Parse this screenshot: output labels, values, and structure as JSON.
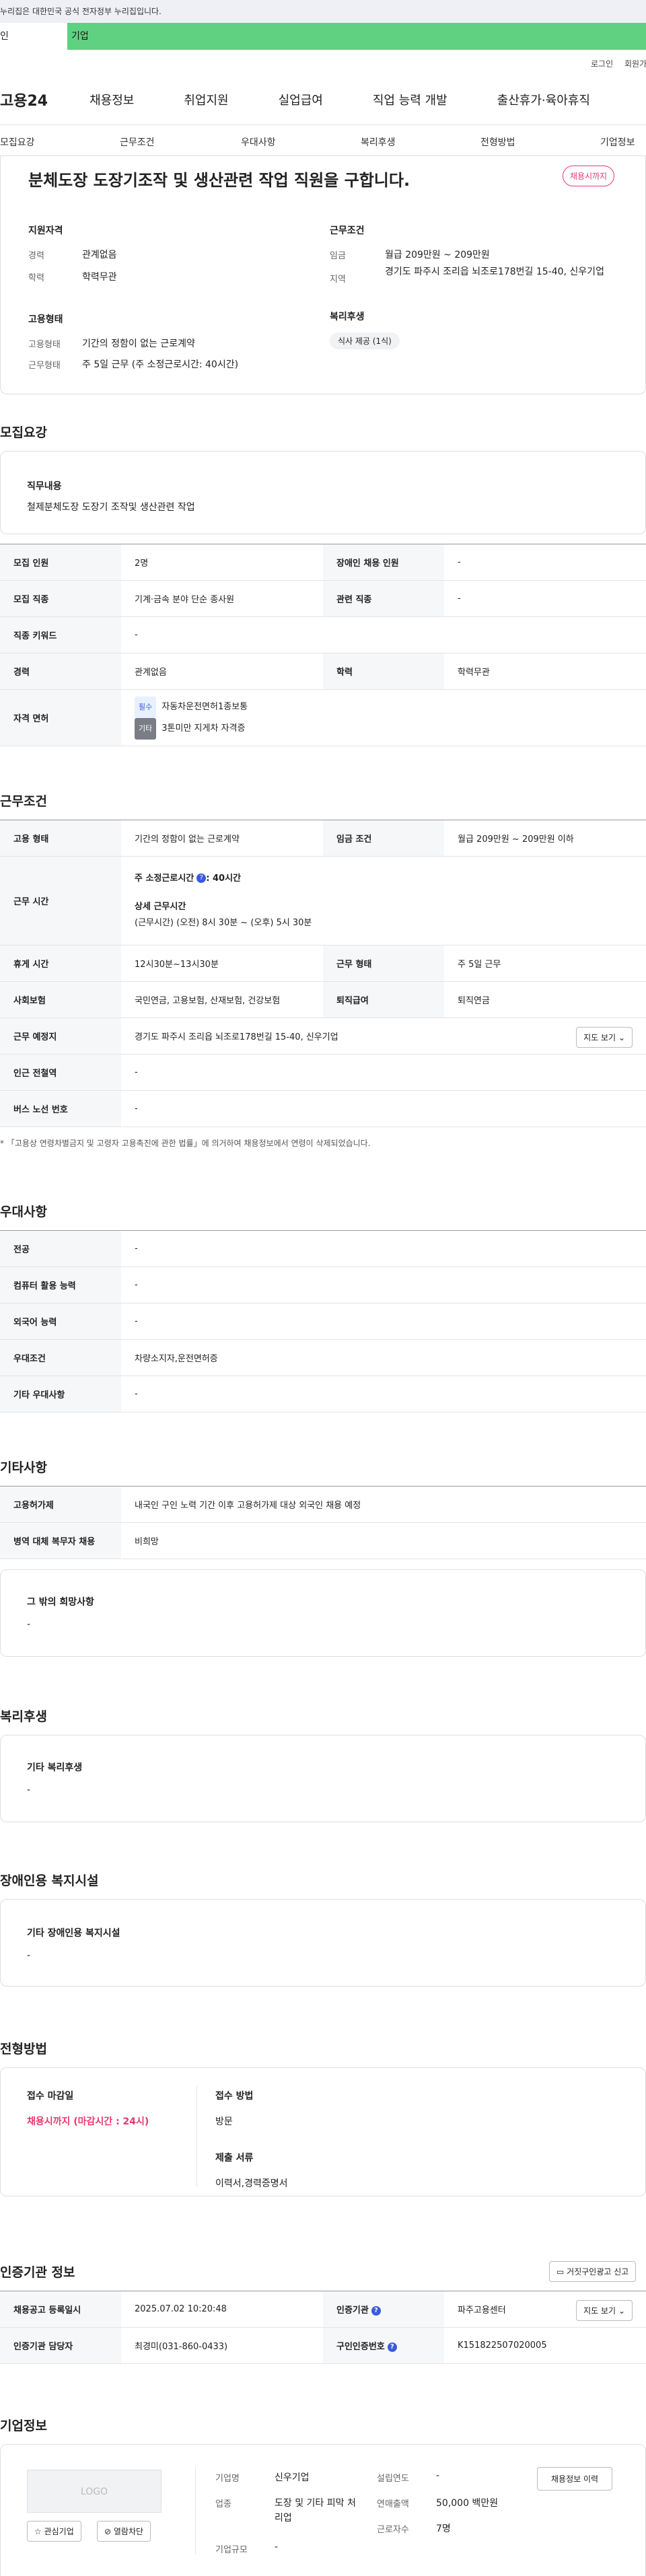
{
  "notice": "누리집은 대한민국 공식 전자정부 누리집입니다.",
  "tabs": {
    "a": "인",
    "b": "기업"
  },
  "util": {
    "login": "로그인",
    "join": "회원가"
  },
  "gnb": {
    "logo": "고용24",
    "items": [
      "채용정보",
      "취업지원",
      "실업급여",
      "직업 능력 개발",
      "출산휴가·육아휴직"
    ]
  },
  "snb": [
    "모집요강",
    "근무조건",
    "우대사항",
    "복리후생",
    "전형방법",
    "기업정보"
  ],
  "header": {
    "title": "분체도장 도장기조작 및 생산관련 작업 직원을 구합니다.",
    "badge": "채용시까지",
    "qual_title": "지원자격",
    "qual": [
      {
        "k": "경력",
        "v": "관계없음"
      },
      {
        "k": "학력",
        "v": "학력무관"
      }
    ],
    "emp_title": "고용형태",
    "emp": [
      {
        "k": "고용형태",
        "v": "기간의 정함이 없는 근로계약"
      },
      {
        "k": "근무형태",
        "v": "주 5일 근무 (주 소정근로시간: 40시간)"
      }
    ],
    "cond_title": "근무조건",
    "cond": [
      {
        "k": "임금",
        "v": "월급 209만원 ~ 209만원"
      },
      {
        "k": "지역",
        "v": "경기도 파주시 조리읍 뇌조로178번길 15-40, 신우기업"
      }
    ],
    "welfare_title": "복리후생",
    "welfare_tag": "식사 제공 (1식)"
  },
  "recruit": {
    "heading": "모집요강",
    "duty_title": "직무내용",
    "duty": "철제분체도장 도장기 조작및 생산관련  작업",
    "rows": {
      "count_k": "모집 인원",
      "count_v": "2명",
      "disabled_k": "장애인 채용 인원",
      "disabled_v": "-",
      "job_k": "모집 직종",
      "job_v": "기계·금속 분야 단순 종사원",
      "rel_k": "관련 직종",
      "rel_v": "-",
      "kw_k": "직종 키워드",
      "kw_v": "-",
      "career_k": "경력",
      "career_v": "관계없음",
      "edu_k": "학력",
      "edu_v": "학력무관",
      "license_k": "자격 면허",
      "lic1_tag": "필수",
      "lic1": "자동차운전면허1종보통",
      "lic2_tag": "기타",
      "lic2": "3톤미만 지게차 자격증"
    }
  },
  "work": {
    "heading": "근무조건",
    "type_k": "고용 형태",
    "type_v": "기간의 정함이 없는 근로계약",
    "pay_k": "임금 조건",
    "pay_v": "월급 209만원 ~ 209만원 이하",
    "time_k": "근무 시간",
    "time_a": "주 소정근로시간",
    "time_a_v": ": 40시간",
    "time_b": "상세 근무시간",
    "time_b_v": "(근무시간) (오전) 8시 30분 ~ (오후) 5시 30분",
    "rest_k": "휴게 시간",
    "rest_v": "12시30분~13시30분",
    "form_k": "근무 형태",
    "form_v": "주 5일 근무",
    "ins_k": "사회보험",
    "ins_v": "국민연금, 고용보험, 산재보험, 건강보험",
    "retire_k": "퇴직급여",
    "retire_v": "퇴직연금",
    "place_k": "근무 예정지",
    "place_v": "경기도 파주시 조리읍 뇌조로178번길 15-40, 신우기업",
    "map_btn": "지도 보기",
    "station_k": "인근 전철역",
    "station_v": "-",
    "bus_k": "버스 노선 번호",
    "bus_v": "-",
    "footnote": "* 「고용상 연령차별금지 및 고령자 고용촉진에 관한 법률」에 의거하여 채용정보에서 연령이 삭제되었습니다."
  },
  "pref": {
    "heading": "우대사항",
    "rows": [
      {
        "k": "전공",
        "v": "-"
      },
      {
        "k": "컴퓨터 활용 능력",
        "v": "-"
      },
      {
        "k": "외국어 능력",
        "v": "-"
      },
      {
        "k": "우대조건",
        "v": "차량소지자,운전면허증"
      },
      {
        "k": "기타 우대사항",
        "v": "-"
      }
    ]
  },
  "etc": {
    "heading": "기타사항",
    "rows": [
      {
        "k": "고용허가제",
        "v": "내국인 구인 노력 기간 이후 고용허가제 대상 외국인 채용 예정"
      },
      {
        "k": "병역 대체 복무자 채용",
        "v": "비희망"
      }
    ],
    "other_title": "그 밖의 희망사항",
    "other_v": "-"
  },
  "welfare": {
    "heading": "복리후생",
    "title": "기타 복리후생",
    "v": "-"
  },
  "disability": {
    "heading": "장애인용 복지시설",
    "title": "기타 장애인용 복지시설",
    "v": "-"
  },
  "process": {
    "heading": "전형방법",
    "deadline_k": "접수 마감일",
    "deadline_v": "채용시까지 (마감시간 : 24시)",
    "method_k": "접수 방법",
    "method_v": "방문",
    "docs_k": "제출 서류",
    "docs_v": "이력서,경력증명서"
  },
  "agency": {
    "heading": "인증기관 정보",
    "report_btn": "거짓구인광고 신고",
    "reg_k": "채용공고 등록일시",
    "reg_v": "2025.07.02 10:20:48",
    "org_k": "인증기관",
    "org_v": "파주고용센터",
    "map_btn": "지도 보기",
    "staff_k": "인증기관 담당자",
    "staff_v": "최경미(031-860-0433)",
    "num_k": "구인인증번호",
    "num_v": "K151822507020005"
  },
  "company": {
    "heading": "기업정보",
    "logo": "LOGO",
    "fav_btn": "관심기업",
    "block_btn": "열람차단",
    "name_k": "기업명",
    "name_v": "신우기업",
    "ind_k": "업종",
    "ind_v": "도장 및 기타 피막 처리업",
    "size_k": "기업규모",
    "size_v": "-",
    "est_k": "설립연도",
    "est_v": "-",
    "sales_k": "연매출액",
    "sales_v": "50,000 백만원",
    "emp_k": "근로자수",
    "emp_v": "7명",
    "hist_btn": "채용정보 이력"
  }
}
